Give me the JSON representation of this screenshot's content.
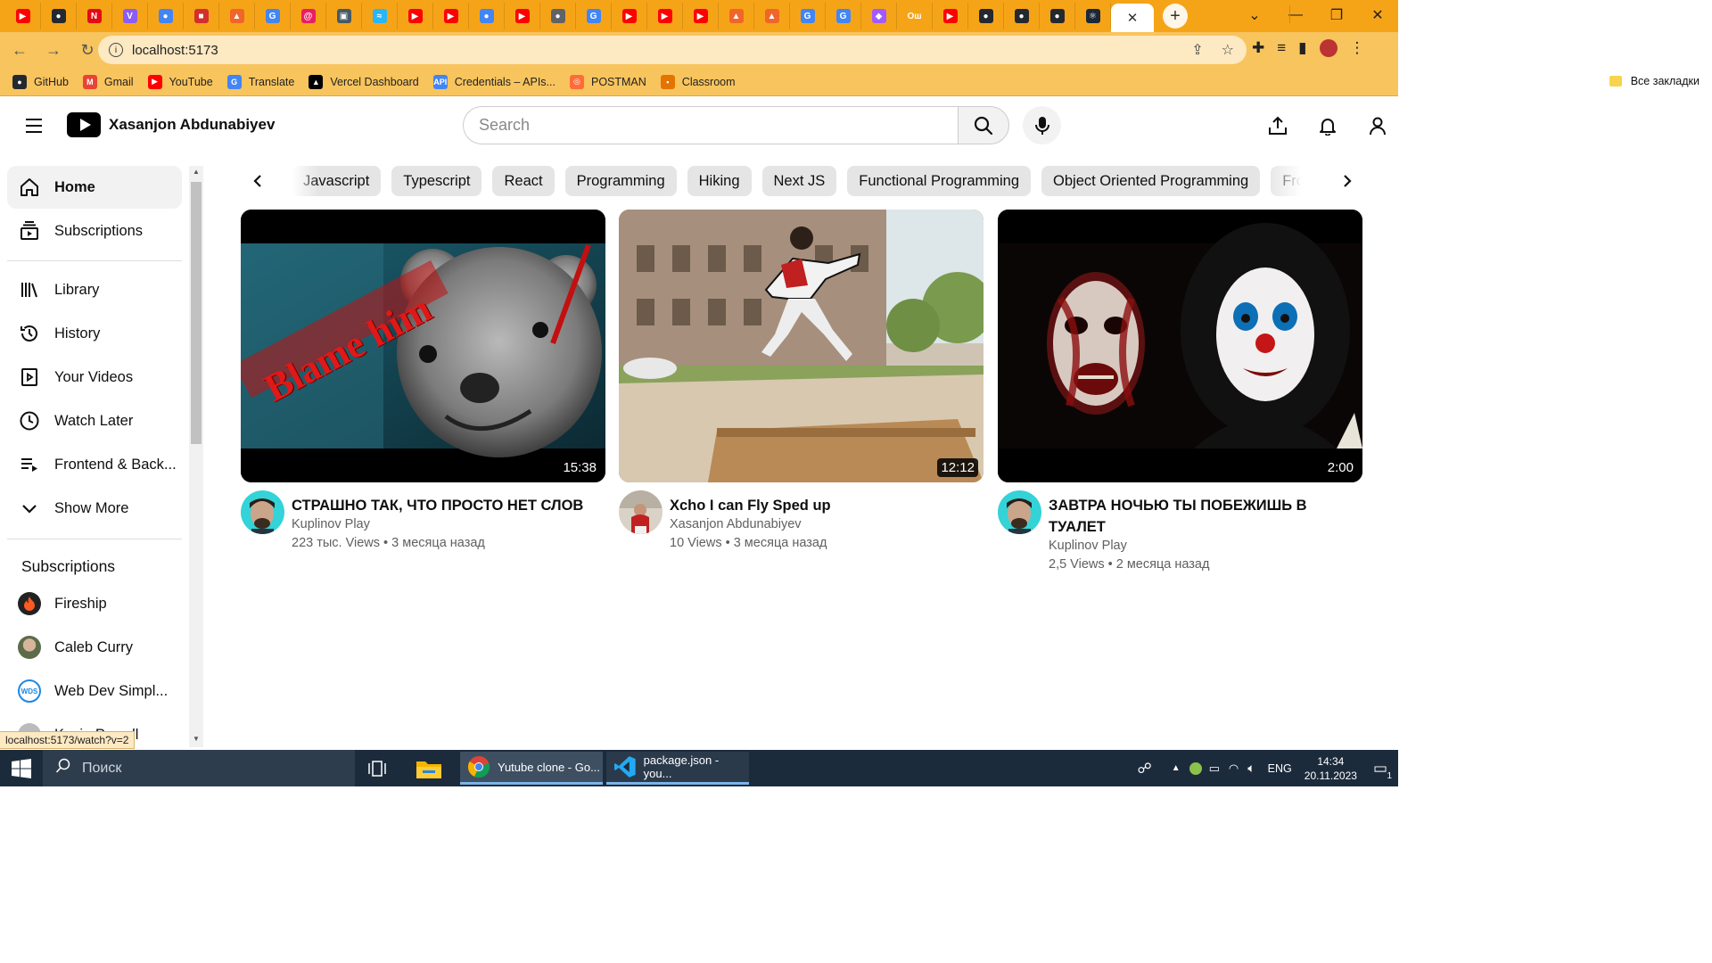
{
  "browser": {
    "tabs": [
      {
        "icon": "youtube-icon",
        "color": "#ff0000",
        "glyph": "▶"
      },
      {
        "icon": "github-icon",
        "color": "#24292f",
        "glyph": "●"
      },
      {
        "icon": "netflix-icon",
        "color": "#e50914",
        "glyph": "N"
      },
      {
        "icon": "vite-icon",
        "color": "#8b5cf6",
        "glyph": "V"
      },
      {
        "icon": "chrome-icon",
        "color": "#4285f4",
        "glyph": "●"
      },
      {
        "icon": "red-app-icon",
        "color": "#d32f2f",
        "glyph": "■"
      },
      {
        "icon": "app-icon",
        "color": "#f06529",
        "glyph": "▲"
      },
      {
        "icon": "google-icon",
        "color": "#4285f4",
        "glyph": "G"
      },
      {
        "icon": "swirl-icon",
        "color": "#e91e63",
        "glyph": "@"
      },
      {
        "icon": "image-icon",
        "color": "#455a64",
        "glyph": "▣"
      },
      {
        "icon": "wave-icon",
        "color": "#29b6f6",
        "glyph": "≈"
      },
      {
        "icon": "youtube-icon",
        "color": "#ff0000",
        "glyph": "▶"
      },
      {
        "icon": "youtube-icon",
        "color": "#ff0000",
        "glyph": "▶"
      },
      {
        "icon": "chrome-icon",
        "color": "#4285f4",
        "glyph": "●"
      },
      {
        "icon": "youtube-icon",
        "color": "#ff0000",
        "glyph": "▶"
      },
      {
        "icon": "chrome-icon",
        "color": "#5f6368",
        "glyph": "●"
      },
      {
        "icon": "google-icon",
        "color": "#4285f4",
        "glyph": "G"
      },
      {
        "icon": "youtube-icon",
        "color": "#ff0000",
        "glyph": "▶"
      },
      {
        "icon": "youtube-icon",
        "color": "#ff0000",
        "glyph": "▶"
      },
      {
        "icon": "youtube-icon",
        "color": "#ff0000",
        "glyph": "▶"
      },
      {
        "icon": "app-icon",
        "color": "#f06529",
        "glyph": "▲"
      },
      {
        "icon": "app-icon",
        "color": "#f06529",
        "glyph": "▲"
      },
      {
        "icon": "google-icon",
        "color": "#4285f4",
        "glyph": "G"
      },
      {
        "icon": "google-icon",
        "color": "#4285f4",
        "glyph": "G"
      },
      {
        "icon": "figma-icon",
        "color": "#a259ff",
        "glyph": "◆"
      },
      {
        "icon": "text-tab",
        "color": "#f6a417",
        "glyph": "Ош"
      },
      {
        "icon": "youtube-icon",
        "color": "#ff0000",
        "glyph": "▶"
      },
      {
        "icon": "github-icon",
        "color": "#24292f",
        "glyph": "●"
      },
      {
        "icon": "github-icon",
        "color": "#24292f",
        "glyph": "●"
      },
      {
        "icon": "github-icon",
        "color": "#24292f",
        "glyph": "●"
      },
      {
        "icon": "react-icon",
        "color": "#1b2838",
        "glyph": "⚛"
      }
    ],
    "url": "localhost:5173",
    "bookmarks": [
      {
        "label": "GitHub",
        "icon": "github-icon",
        "color": "#24292f",
        "glyph": "●"
      },
      {
        "label": "Gmail",
        "icon": "gmail-icon",
        "color": "#ea4335",
        "glyph": "M"
      },
      {
        "label": "YouTube",
        "icon": "youtube-icon",
        "color": "#ff0000",
        "glyph": "▶"
      },
      {
        "label": "Translate",
        "icon": "translate-icon",
        "color": "#4285f4",
        "glyph": "G"
      },
      {
        "label": "Vercel Dashboard",
        "icon": "vercel-icon",
        "color": "#000000",
        "glyph": "▲"
      },
      {
        "label": "Credentials – APIs...",
        "icon": "api-icon",
        "color": "#4285f4",
        "glyph": "API"
      },
      {
        "label": "POSTMAN",
        "icon": "postman-icon",
        "color": "#ff6c37",
        "glyph": "◎"
      },
      {
        "label": "Classroom",
        "icon": "classroom-icon",
        "color": "#e37400",
        "glyph": "▪"
      }
    ],
    "all_bookmarks": "Все закладки",
    "status_url": "localhost:5173/watch?v=2"
  },
  "header": {
    "brand": "Xasanjon Abdunabiyev",
    "search_placeholder": "Search"
  },
  "sidebar": {
    "primary": [
      {
        "label": "Home",
        "icon": "home-icon"
      },
      {
        "label": "Subscriptions",
        "icon": "subscriptions-icon"
      }
    ],
    "library": [
      {
        "label": "Library",
        "icon": "library-icon"
      },
      {
        "label": "History",
        "icon": "history-icon"
      },
      {
        "label": "Your Videos",
        "icon": "your-videos-icon"
      },
      {
        "label": "Watch Later",
        "icon": "watch-later-icon"
      },
      {
        "label": "Frontend & Back...",
        "icon": "playlist-icon"
      },
      {
        "label": "Show More",
        "icon": "chevron-down-icon"
      }
    ],
    "subscriptions_heading": "Subscriptions",
    "subscriptions": [
      {
        "label": "Fireship",
        "color": "#e4572e"
      },
      {
        "label": "Caleb Curry",
        "color": "#6b7b55"
      },
      {
        "label": "Web Dev Simpl...",
        "color": "#1e88e5"
      },
      {
        "label": "Kevin Powell",
        "color": "#444444"
      }
    ]
  },
  "chips": [
    "Javascript",
    "Typescript",
    "React",
    "Programming",
    "Hiking",
    "Next JS",
    "Functional Programming",
    "Object Oriented Programming",
    "Frontend"
  ],
  "videos": [
    {
      "title": "СТРАШНО ТАК, ЧТО ПРОСТО НЕТ СЛОВ",
      "channel": "Kuplinov Play",
      "views": "223 тыс. Views",
      "posted": "3 месяца назад",
      "duration": "15:38",
      "thumb_text": "Blame him"
    },
    {
      "title": "Xcho I can Fly Sped up",
      "channel": "Xasanjon Abdunabiyev",
      "views": "10 Views",
      "posted": "3 месяца назад",
      "duration": "12:12"
    },
    {
      "title": "ЗАВТРА НОЧЬЮ ТЫ ПОБЕЖИШЬ В ТУАЛЕТ",
      "channel": "Kuplinov Play",
      "views": "2,5 Views",
      "posted": "2 месяца назад",
      "duration": "2:00"
    }
  ],
  "taskbar": {
    "search_placeholder": "Поиск",
    "apps": [
      {
        "label": "Yutube clone - Go...",
        "icon": "chrome-icon"
      },
      {
        "label": "package.json - you...",
        "icon": "vscode-icon"
      }
    ],
    "language": "ENG",
    "time": "14:34",
    "date": "20.11.2023",
    "notifications": "1"
  }
}
